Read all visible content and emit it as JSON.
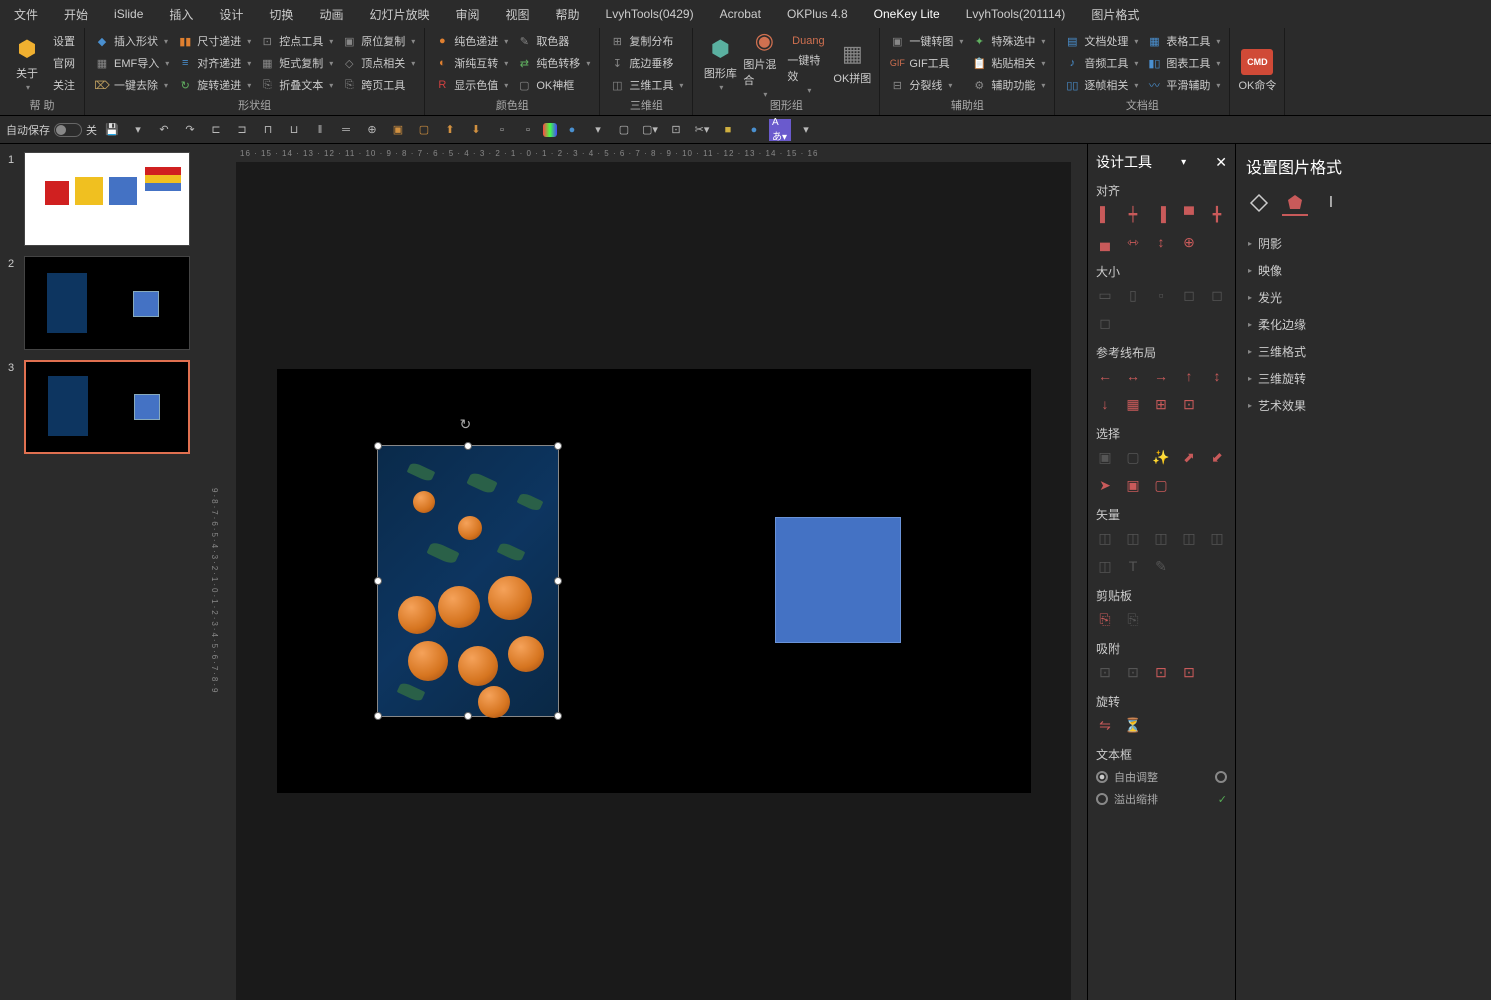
{
  "menu": [
    "文件",
    "开始",
    "iSlide",
    "插入",
    "设计",
    "切换",
    "动画",
    "幻灯片放映",
    "审阅",
    "视图",
    "帮助",
    "LvyhTools(0429)",
    "Acrobat",
    "OKPlus 4.8",
    "OneKey Lite",
    "LvyhTools(201114)",
    "图片格式"
  ],
  "menu_active": 14,
  "ribbon": {
    "help": {
      "settings": "设置",
      "website": "官网",
      "watch": "关注",
      "about": "关于",
      "label": "帮 助"
    },
    "shape": {
      "items": [
        "插入形状",
        "EMF导入",
        "一键去除",
        "尺寸递进",
        "对齐递进",
        "旋转递进",
        "控点工具",
        "矩式复制",
        "折叠文本",
        "原位复制",
        "顶点相关",
        "跨页工具"
      ],
      "label": "形状组"
    },
    "color": {
      "items": [
        "纯色递进",
        "渐纯互转",
        "显示色值",
        "取色器",
        "纯色转移",
        "OK神框"
      ],
      "label": "颜色组"
    },
    "three": {
      "items": [
        "复制分布",
        "底边垂移",
        "三维工具"
      ],
      "label": "三维组"
    },
    "pic": {
      "lib": "图形库",
      "blend": "图片混合",
      "onekey": "一键特效",
      "spell": "OK拼图",
      "label": "图形组"
    },
    "aux": {
      "items": [
        "一键转图",
        "GIF工具",
        "分裂线",
        "特殊选中",
        "粘贴相关",
        "辅助功能"
      ],
      "label": "辅助组"
    },
    "doc": {
      "items": [
        "文档处理",
        "音频工具",
        "逐帧相关",
        "表格工具",
        "图表工具",
        "平滑辅助"
      ],
      "label": "文档组"
    },
    "cmd": {
      "label": "OK命令",
      "badge": "CMD"
    }
  },
  "qat": {
    "autosave": "自动保存",
    "off": "关"
  },
  "ruler_h": "16 · 15 · 14 · 13 · 12 · 11 · 10 · 9 · 8 · 7 · 6 · 5 · 4 · 3 · 2 · 1 · 0 · 1 · 2 · 3 · 4 · 5 · 6 · 7 · 8 · 9 · 10 · 11 · 12 · 13 · 14 · 15 · 16",
  "ruler_v": "9·8·7·6·5·4·3·2·1·0·1·2·3·4·5·6·7·8·9",
  "thumbs": [
    1,
    2,
    3
  ],
  "design": {
    "title": "设计工具",
    "sections": {
      "align": "对齐",
      "size": "大小",
      "guides": "参考线布局",
      "select": "选择",
      "vector": "矢量",
      "clipboard": "剪贴板",
      "snap": "吸附",
      "rotate": "旋转",
      "textbox": "文本框"
    },
    "radio1": "自由调整",
    "radio2": "溢出缩排"
  },
  "format": {
    "title": "设置图片格式",
    "items": [
      "阴影",
      "映像",
      "发光",
      "柔化边缘",
      "三维格式",
      "三维旋转",
      "艺术效果"
    ]
  }
}
